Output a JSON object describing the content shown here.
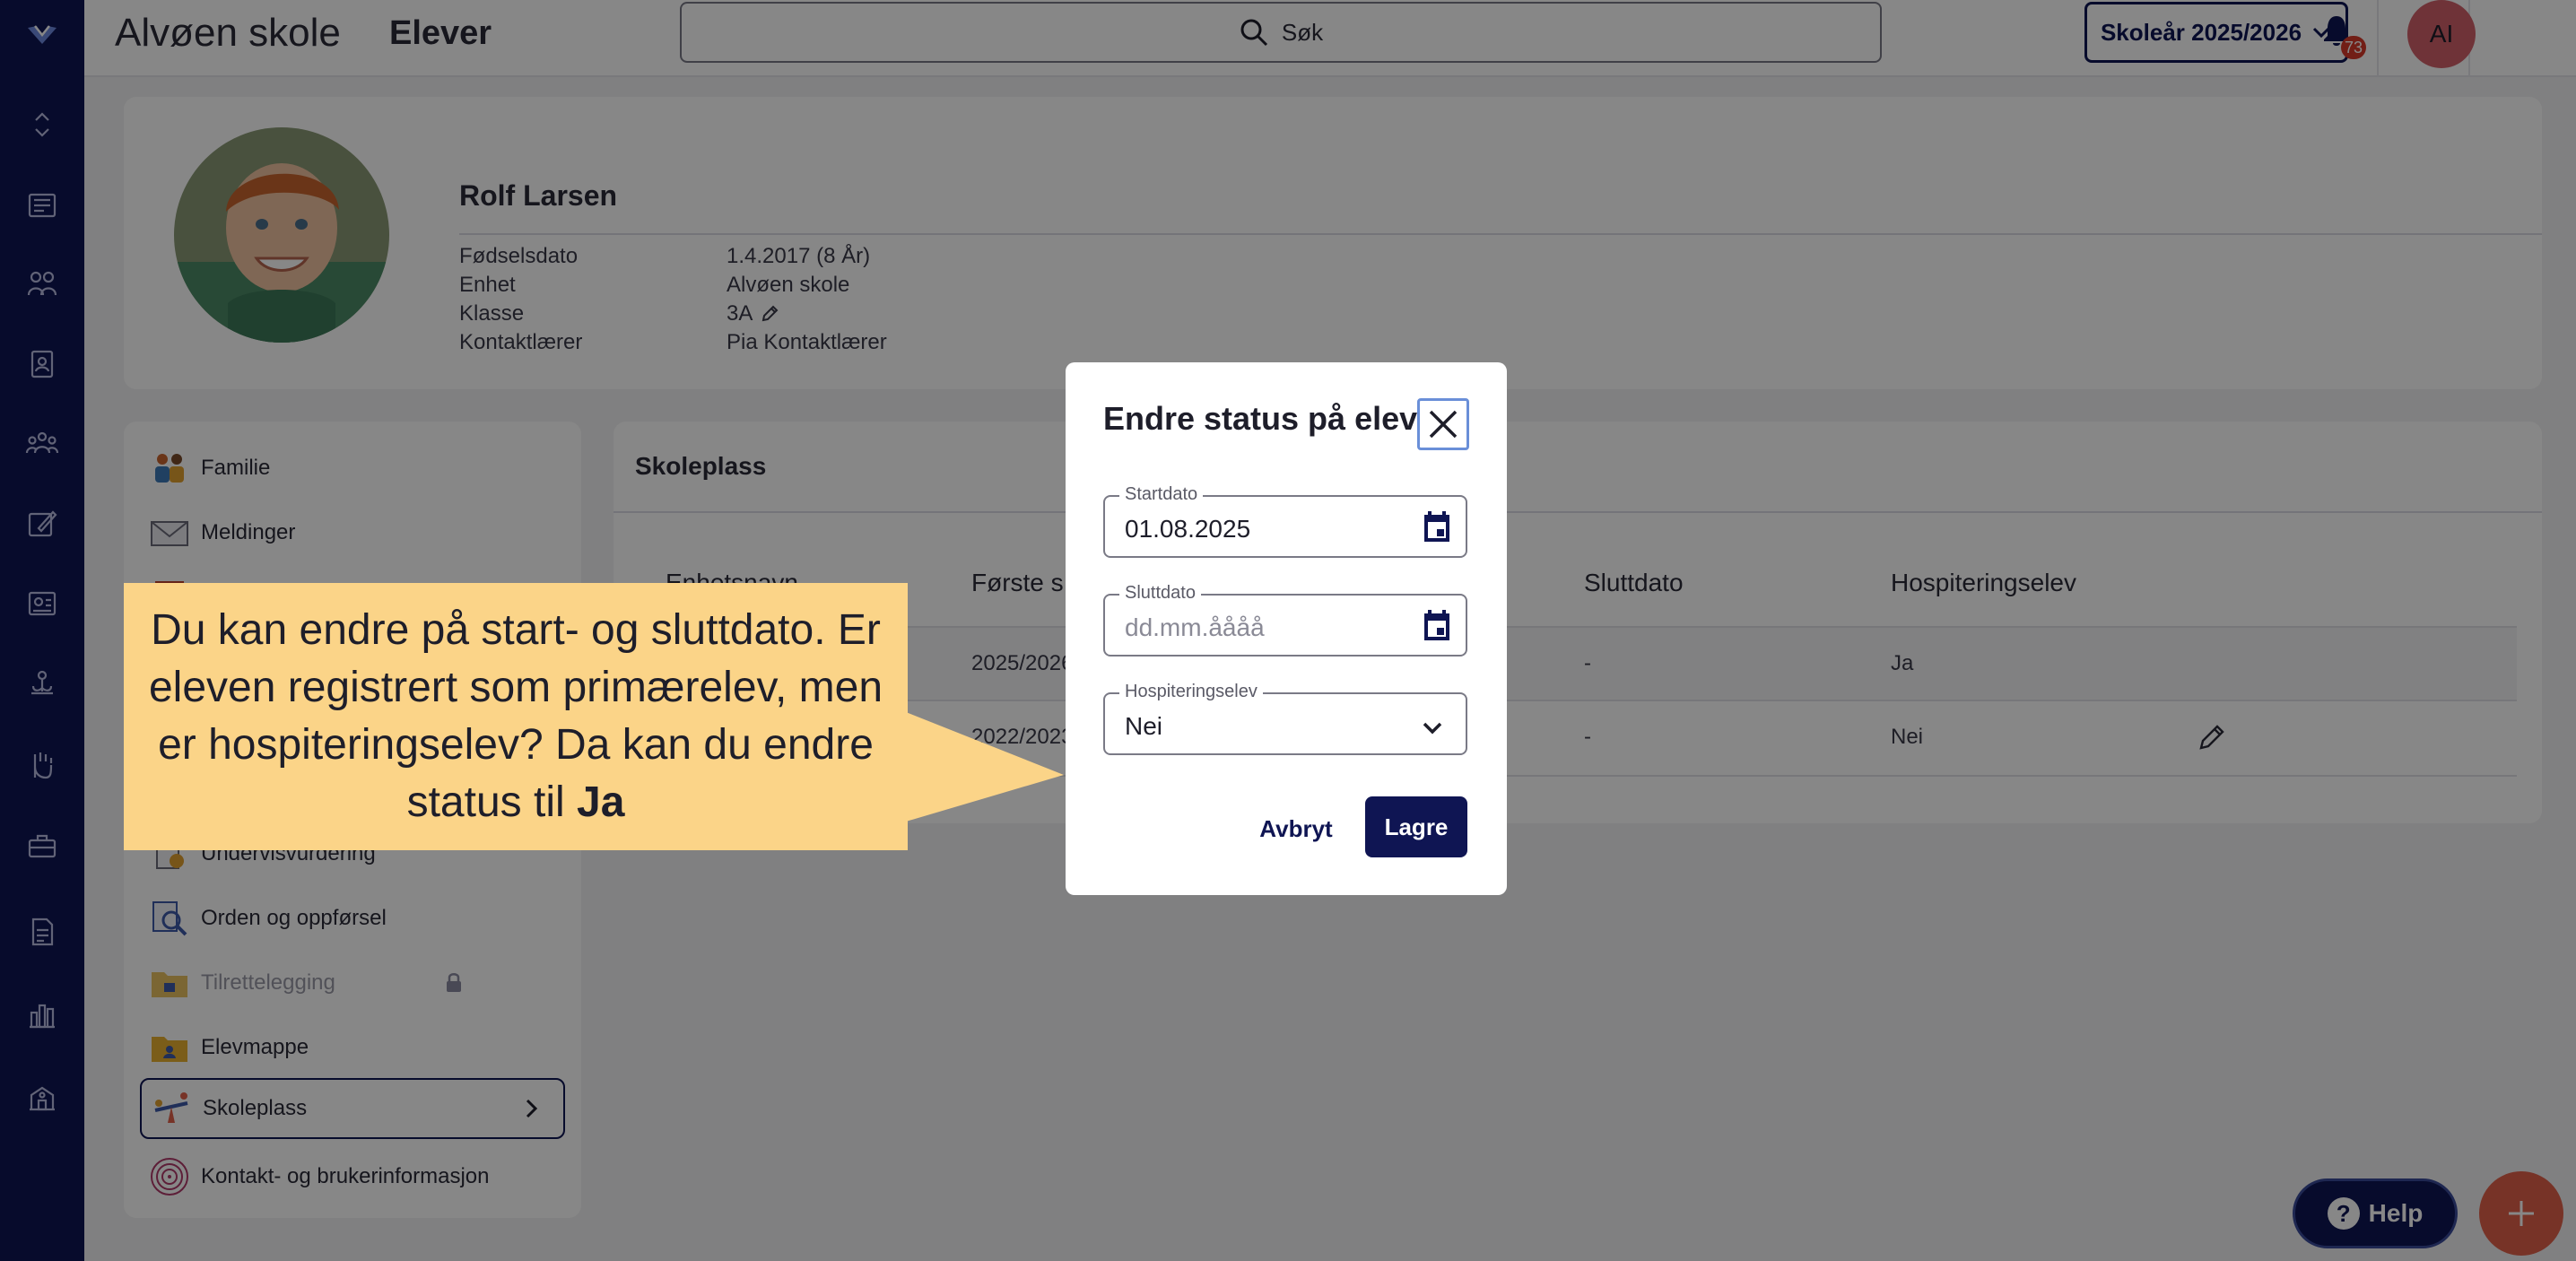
{
  "app": {
    "logo_icon": "heart-logo-icon",
    "school_name": "Alvøen skole",
    "section": "Elever"
  },
  "search": {
    "label": "Søk"
  },
  "school_year": {
    "label": "Skoleår 2025/2026"
  },
  "notifications": {
    "count": "73"
  },
  "user": {
    "initials": "AI"
  },
  "rail": {
    "icons": [
      "collapse-icon",
      "news-icon",
      "users-icon",
      "clipboard-icon",
      "groups-icon",
      "pencil-board-icon",
      "book-icon",
      "scale-icon",
      "hand-icon",
      "briefcase-icon",
      "document-icon",
      "bar-chart-icon",
      "school-icon"
    ]
  },
  "student": {
    "name": "Rolf Larsen",
    "fields": [
      {
        "key": "Fødselsdato",
        "value": "1.4.2017 (8 År)"
      },
      {
        "key": "Enhet",
        "value": "Alvøen skole"
      },
      {
        "key": "Klasse",
        "value": "3A"
      },
      {
        "key": "Kontaktlærer",
        "value": "Pia Kontaktlærer"
      }
    ]
  },
  "menu": {
    "items": [
      {
        "label": "Familie",
        "icon": "family-icon"
      },
      {
        "label": "Meldinger",
        "icon": "envelope-icon"
      },
      {
        "label": "Undervisvurdering",
        "icon": "assessment-icon"
      },
      {
        "label": "Orden og oppførsel",
        "icon": "magnifier-document-icon"
      },
      {
        "label": "Tilrettelegging",
        "icon": "folder-lock-icon"
      },
      {
        "label": "Elevmappe",
        "icon": "student-folder-icon"
      },
      {
        "label": "Skoleplass",
        "icon": "seesaw-icon"
      },
      {
        "label": "Kontakt- og brukerinformasjon",
        "icon": "fingerprint-icon"
      }
    ]
  },
  "skoleplass": {
    "title": "Skoleplass",
    "columns": [
      "Enhetsnavn",
      "Første s",
      "Sluttdato",
      "Hospiteringselev"
    ],
    "rows": [
      {
        "first": "2025/2026",
        "end": "-",
        "hosp": "Ja"
      },
      {
        "first": "2022/2023",
        "end": "-",
        "hosp": "Nei"
      }
    ]
  },
  "dialog": {
    "title": "Endre status på elev",
    "start_label": "Startdato",
    "start_value": "01.08.2025",
    "end_label": "Sluttdato",
    "end_placeholder": "dd.mm.åååå",
    "hosp_label": "Hospiteringselev",
    "hosp_value": "Nei",
    "cancel": "Avbryt",
    "save": "Lagre"
  },
  "callout": {
    "text": "Du kan endre på start- og sluttdato. Er eleven registrert som primærelev, men er hospiteringselev? Da kan du endre status til ",
    "emphasis": "Ja"
  },
  "help": {
    "label": "Help"
  },
  "colors": {
    "navy": "#0f1553",
    "callout": "#fbd488",
    "fab": "#e0604a",
    "badge": "#d83a2b"
  }
}
